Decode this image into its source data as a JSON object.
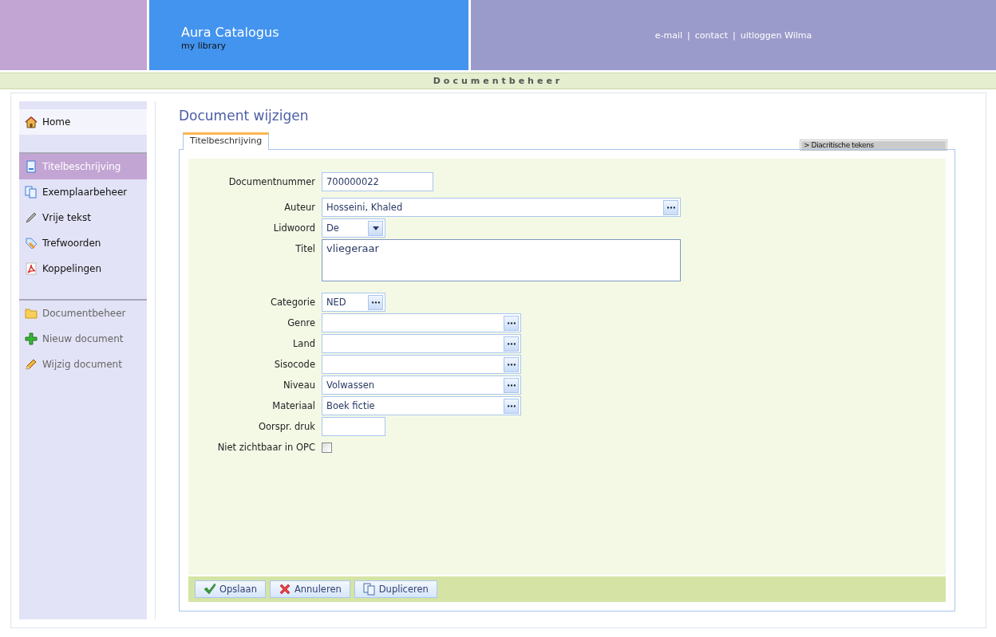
{
  "header": {
    "app_title": "Aura Catalogus",
    "subtitle": "my library",
    "separator": "|",
    "links": [
      "e-mail",
      "contact",
      "uitloggen Wilma"
    ]
  },
  "section_bar": {
    "title": "Documentbeheer"
  },
  "sidebar": {
    "groups": [
      {
        "items": [
          {
            "label": "Home",
            "selected": false,
            "disabled": false
          }
        ]
      },
      {
        "items": [
          {
            "label": "Titelbeschrijving",
            "selected": true,
            "disabled": false
          },
          {
            "label": "Exemplaarbeheer",
            "selected": false,
            "disabled": false
          },
          {
            "label": "Vrije tekst",
            "selected": false,
            "disabled": false
          },
          {
            "label": "Trefwoorden",
            "selected": false,
            "disabled": false
          },
          {
            "label": "Koppelingen",
            "selected": false,
            "disabled": false
          }
        ]
      },
      {
        "items": [
          {
            "label": "Documentbeheer",
            "selected": false,
            "disabled": true
          },
          {
            "label": "Nieuw document",
            "selected": false,
            "disabled": true
          },
          {
            "label": "Wijzig document",
            "selected": false,
            "disabled": true
          }
        ]
      }
    ]
  },
  "page_title": "Document wijzigen",
  "tabs": [
    {
      "label": "Titelbeschrijving",
      "selected": true
    }
  ],
  "diacritics_toggle": {
    "arrow": ">",
    "label": "Diacritische tekens"
  },
  "form": {
    "fields": [
      {
        "label": "Documentnummer",
        "kind": "text",
        "value": "700000022"
      },
      {
        "label": "Auteur",
        "kind": "lookup",
        "value": "Hosseini, Khaled"
      },
      {
        "label": "Lidwoord",
        "kind": "dropdown",
        "value": "De"
      },
      {
        "label": "Titel",
        "kind": "textarea",
        "value": "vliegeraar"
      },
      {
        "label": "Categorie",
        "kind": "lookup",
        "value": "NED"
      },
      {
        "label": "Genre",
        "kind": "lookup"
      },
      {
        "label": "Land",
        "kind": "lookup"
      },
      {
        "label": "Sisocode",
        "kind": "lookup"
      },
      {
        "label": "Niveau",
        "kind": "lookup",
        "value": "Volwassen"
      },
      {
        "label": "Materiaal",
        "kind": "lookup",
        "value": "Boek fictie"
      },
      {
        "label": "Oorspr. druk",
        "kind": "text"
      },
      {
        "label": "Niet zichtbaar in OPC",
        "kind": "checkbox",
        "checked": false
      }
    ]
  },
  "buttons": [
    {
      "label": "Opslaan"
    },
    {
      "label": "Annuleren"
    },
    {
      "label": "Dupliceren"
    }
  ]
}
